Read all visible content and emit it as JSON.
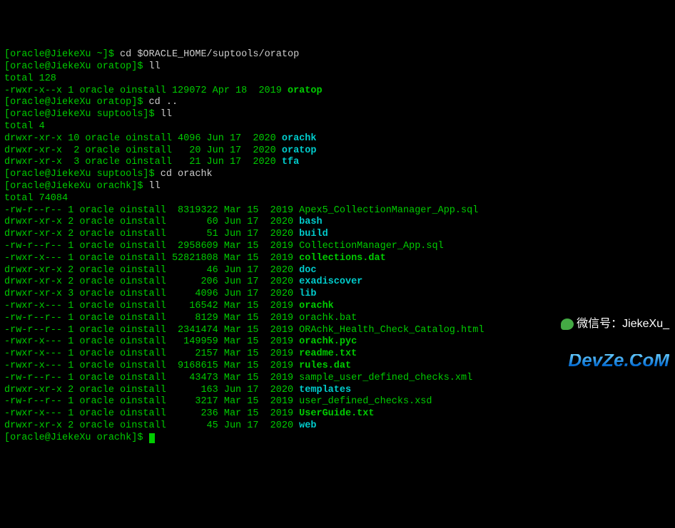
{
  "prompts": [
    {
      "user": "oracle",
      "host": "JiekeXu",
      "dir": "~",
      "cmd": "cd $ORACLE_HOME/suptools/oratop"
    },
    {
      "user": "oracle",
      "host": "JiekeXu",
      "dir": "oratop",
      "cmd": "ll"
    }
  ],
  "total1": "total 128",
  "file1": {
    "perms": "-rwxr-x--x",
    "links": "1",
    "owner": "oracle",
    "group": "oinstall",
    "size": "129072",
    "date": "Apr 18  2019",
    "name": "oratop",
    "bold": true
  },
  "prompt3": {
    "user": "oracle",
    "host": "JiekeXu",
    "dir": "oratop",
    "cmd": "cd .."
  },
  "prompt4": {
    "user": "oracle",
    "host": "JiekeXu",
    "dir": "suptools",
    "cmd": "ll"
  },
  "total2": "total 4",
  "suptools": [
    {
      "perms": "drwxr-xr-x",
      "links": "10",
      "owner": "oracle",
      "group": "oinstall",
      "size": "4096",
      "date": "Jun 17  2020",
      "name": "orachk",
      "cyan": true
    },
    {
      "perms": "drwxr-xr-x",
      "links": " 2",
      "owner": "oracle",
      "group": "oinstall",
      "size": "  20",
      "date": "Jun 17  2020",
      "name": "oratop",
      "cyan": true
    },
    {
      "perms": "drwxr-xr-x",
      "links": " 3",
      "owner": "oracle",
      "group": "oinstall",
      "size": "  21",
      "date": "Jun 17  2020",
      "name": "tfa",
      "cyan": true
    }
  ],
  "prompt5": {
    "user": "oracle",
    "host": "JiekeXu",
    "dir": "suptools",
    "cmd": "cd orachk"
  },
  "prompt6": {
    "user": "oracle",
    "host": "JiekeXu",
    "dir": "orachk",
    "cmd": "ll"
  },
  "total3": "total 74084",
  "orachk": [
    {
      "perms": "-rw-r--r--",
      "links": "1",
      "owner": "oracle",
      "group": "oinstall",
      "size": " 8319322",
      "date": "Mar 15  2019",
      "name": "Apex5_CollectionManager_App.sql"
    },
    {
      "perms": "drwxr-xr-x",
      "links": "2",
      "owner": "oracle",
      "group": "oinstall",
      "size": "      60",
      "date": "Jun 17  2020",
      "name": "bash",
      "cyan": true
    },
    {
      "perms": "drwxr-xr-x",
      "links": "2",
      "owner": "oracle",
      "group": "oinstall",
      "size": "      51",
      "date": "Jun 17  2020",
      "name": "build",
      "cyan": true
    },
    {
      "perms": "-rw-r--r--",
      "links": "1",
      "owner": "oracle",
      "group": "oinstall",
      "size": " 2958609",
      "date": "Mar 15  2019",
      "name": "CollectionManager_App.sql"
    },
    {
      "perms": "-rwxr-x---",
      "links": "1",
      "owner": "oracle",
      "group": "oinstall",
      "size": "52821808",
      "date": "Mar 15  2019",
      "name": "collections.dat",
      "bold": true
    },
    {
      "perms": "drwxr-xr-x",
      "links": "2",
      "owner": "oracle",
      "group": "oinstall",
      "size": "      46",
      "date": "Jun 17  2020",
      "name": "doc",
      "cyan": true
    },
    {
      "perms": "drwxr-xr-x",
      "links": "2",
      "owner": "oracle",
      "group": "oinstall",
      "size": "     206",
      "date": "Jun 17  2020",
      "name": "exadiscover",
      "cyan": true
    },
    {
      "perms": "drwxr-xr-x",
      "links": "3",
      "owner": "oracle",
      "group": "oinstall",
      "size": "    4096",
      "date": "Jun 17  2020",
      "name": "lib",
      "cyan": true
    },
    {
      "perms": "-rwxr-x---",
      "links": "1",
      "owner": "oracle",
      "group": "oinstall",
      "size": "   16542",
      "date": "Mar 15  2019",
      "name": "orachk",
      "bold": true
    },
    {
      "perms": "-rw-r--r--",
      "links": "1",
      "owner": "oracle",
      "group": "oinstall",
      "size": "    8129",
      "date": "Mar 15  2019",
      "name": "orachk.bat"
    },
    {
      "perms": "-rw-r--r--",
      "links": "1",
      "owner": "oracle",
      "group": "oinstall",
      "size": " 2341474",
      "date": "Mar 15  2019",
      "name": "ORAchk_Health_Check_Catalog.html"
    },
    {
      "perms": "-rwxr-x---",
      "links": "1",
      "owner": "oracle",
      "group": "oinstall",
      "size": "  149959",
      "date": "Mar 15  2019",
      "name": "orachk.pyc",
      "bold": true
    },
    {
      "perms": "-rwxr-x---",
      "links": "1",
      "owner": "oracle",
      "group": "oinstall",
      "size": "    2157",
      "date": "Mar 15  2019",
      "name": "readme.txt",
      "bold": true
    },
    {
      "perms": "-rwxr-x---",
      "links": "1",
      "owner": "oracle",
      "group": "oinstall",
      "size": " 9168615",
      "date": "Mar 15  2019",
      "name": "rules.dat",
      "bold": true
    },
    {
      "perms": "-rw-r--r--",
      "links": "1",
      "owner": "oracle",
      "group": "oinstall",
      "size": "   43473",
      "date": "Mar 15  2019",
      "name": "sample_user_defined_checks.xml"
    },
    {
      "perms": "drwxr-xr-x",
      "links": "2",
      "owner": "oracle",
      "group": "oinstall",
      "size": "     163",
      "date": "Jun 17  2020",
      "name": "templates",
      "cyan": true
    },
    {
      "perms": "-rw-r--r--",
      "links": "1",
      "owner": "oracle",
      "group": "oinstall",
      "size": "    3217",
      "date": "Mar 15  2019",
      "name": "user_defined_checks.xsd"
    },
    {
      "perms": "-rwxr-x---",
      "links": "1",
      "owner": "oracle",
      "group": "oinstall",
      "size": "     236",
      "date": "Mar 15  2019",
      "name": "UserGuide.txt",
      "bold": true
    },
    {
      "perms": "drwxr-xr-x",
      "links": "2",
      "owner": "oracle",
      "group": "oinstall",
      "size": "      45",
      "date": "Jun 17  2020",
      "name": "web",
      "cyan": true
    }
  ],
  "prompt_last": {
    "user": "oracle",
    "host": "JiekeXu",
    "dir": "orachk",
    "cmd": ""
  },
  "watermark": {
    "top": "微信号：JiekeXu_",
    "bot": "DevZe.CoM"
  }
}
